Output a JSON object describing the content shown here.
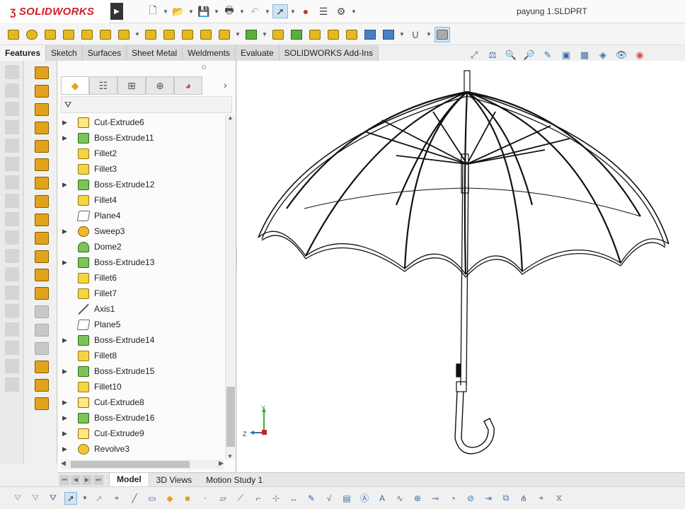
{
  "app": {
    "brand": "SOLIDWORKS",
    "doc_title": "payung 1.SLDPRT"
  },
  "quick_access": [
    "new-icon",
    "open-icon",
    "save-icon",
    "print-icon",
    "undo-icon",
    "select-icon",
    "rebuild-icon",
    "file-properties-icon",
    "options-icon"
  ],
  "command_tabs": [
    {
      "label": "Features",
      "active": true
    },
    {
      "label": "Sketch"
    },
    {
      "label": "Surfaces"
    },
    {
      "label": "Sheet Metal"
    },
    {
      "label": "Weldments"
    },
    {
      "label": "Evaluate"
    },
    {
      "label": "SOLIDWORKS Add-Ins"
    }
  ],
  "feature_tree": [
    {
      "label": "Cut-Extrude6",
      "icon": "cut",
      "expandable": true
    },
    {
      "label": "Boss-Extrude11",
      "icon": "boss",
      "expandable": true
    },
    {
      "label": "Fillet2",
      "icon": "fillet",
      "expandable": false
    },
    {
      "label": "Fillet3",
      "icon": "fillet",
      "expandable": false
    },
    {
      "label": "Boss-Extrude12",
      "icon": "boss",
      "expandable": true
    },
    {
      "label": "Fillet4",
      "icon": "fillet",
      "expandable": false
    },
    {
      "label": "Plane4",
      "icon": "plane",
      "expandable": false
    },
    {
      "label": "Sweep3",
      "icon": "sweep",
      "expandable": true
    },
    {
      "label": "Dome2",
      "icon": "dome",
      "expandable": false
    },
    {
      "label": "Boss-Extrude13",
      "icon": "boss",
      "expandable": true
    },
    {
      "label": "Fillet6",
      "icon": "fillet",
      "expandable": false
    },
    {
      "label": "Fillet7",
      "icon": "fillet",
      "expandable": false
    },
    {
      "label": "Axis1",
      "icon": "axis",
      "expandable": false
    },
    {
      "label": "Plane5",
      "icon": "plane",
      "expandable": false
    },
    {
      "label": "Boss-Extrude14",
      "icon": "boss",
      "expandable": true
    },
    {
      "label": "Fillet8",
      "icon": "fillet",
      "expandable": false
    },
    {
      "label": "Boss-Extrude15",
      "icon": "boss",
      "expandable": true
    },
    {
      "label": "Fillet10",
      "icon": "fillet",
      "expandable": false
    },
    {
      "label": "Cut-Extrude8",
      "icon": "cut",
      "expandable": true
    },
    {
      "label": "Boss-Extrude16",
      "icon": "boss",
      "expandable": true
    },
    {
      "label": "Cut-Extrude9",
      "icon": "cut",
      "expandable": true
    },
    {
      "label": "Revolve3",
      "icon": "rev",
      "expandable": true
    }
  ],
  "bottom_tabs": [
    {
      "label": "Model",
      "active": true
    },
    {
      "label": "3D Views"
    },
    {
      "label": "Motion Study 1"
    }
  ],
  "triad": {
    "x_label": "Z",
    "y_label": "Y"
  }
}
